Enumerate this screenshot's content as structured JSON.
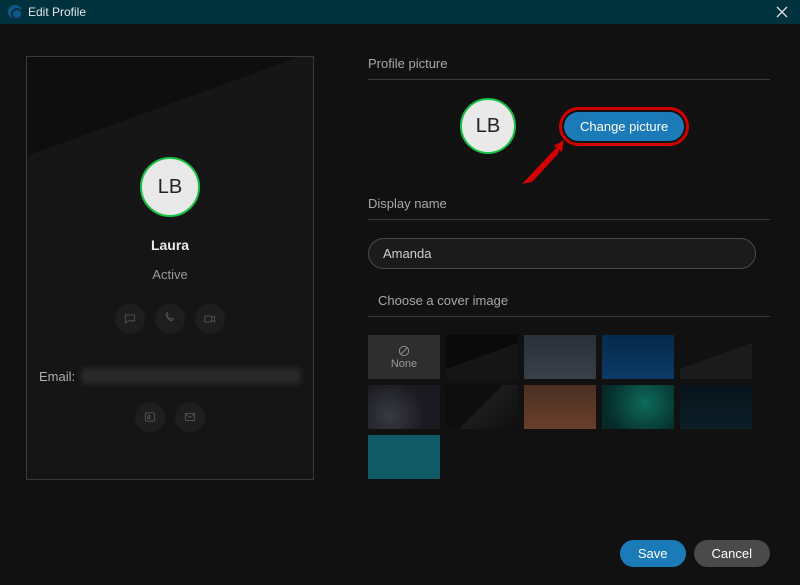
{
  "window": {
    "title": "Edit Profile"
  },
  "card": {
    "avatar_initials": "LB",
    "name": "Laura",
    "status": "Active",
    "email_label": "Email:"
  },
  "profile_picture": {
    "section_label": "Profile picture",
    "avatar_initials": "LB",
    "change_button": "Change picture"
  },
  "display_name": {
    "section_label": "Display name",
    "value": "Amanda"
  },
  "cover": {
    "section_label": "Choose a cover image",
    "none_label": "None",
    "tiles": [
      {
        "id": "none",
        "bg": "#2e2e2e"
      },
      {
        "id": "dark-angle",
        "bg": "linear-gradient(160deg,#0a0a0a 0%,#0a0a0a 48%,#151515 49%,#151515 100%)"
      },
      {
        "id": "grey-wave",
        "bg": "linear-gradient(180deg,#2a3038 0%,#3a4048 100%)"
      },
      {
        "id": "deep-blue",
        "bg": "linear-gradient(180deg,#062a4a 0%,#0a3a66 100%)"
      },
      {
        "id": "charcoal",
        "bg": "linear-gradient(160deg,#111 0%,#111 48%,#1b1b1b 49%,#1b1b1b 100%)"
      },
      {
        "id": "shapes",
        "bg": "radial-gradient(circle at 30% 70%,#3a3a44 0%,#1a1a20 60%)"
      },
      {
        "id": "fold",
        "bg": "linear-gradient(135deg,#0e0e0e 0%,#0e0e0e 48%,#1c1c1c 50%,#0e0e0e 100%)"
      },
      {
        "id": "dunes",
        "bg": "linear-gradient(180deg,#4a2f22 0%,#6a3f2a 100%)"
      },
      {
        "id": "teal",
        "bg": "radial-gradient(circle at 60% 40%,#0e6a5a 0%,#052a28 80%)"
      },
      {
        "id": "night",
        "bg": "linear-gradient(180deg,#08131a 0%,#0c1e28 100%)"
      },
      {
        "id": "cyan",
        "bg": "#105a66"
      }
    ]
  },
  "footer": {
    "save": "Save",
    "cancel": "Cancel"
  },
  "colors": {
    "accent": "#1a7bb8",
    "highlight": "#d20000",
    "presence": "#18c244"
  }
}
